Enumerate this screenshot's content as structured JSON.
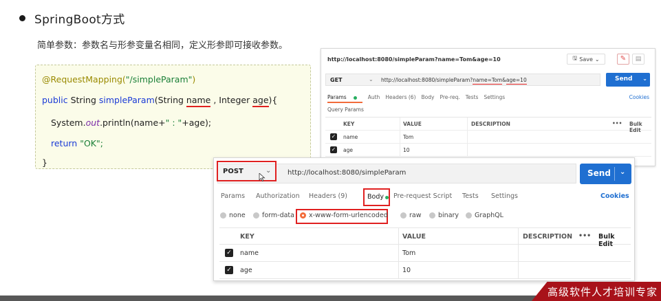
{
  "slide": {
    "heading": "SpringBoot方式",
    "description": "简单参数：参数名与形参变量名相同，定义形参即可接收参数。"
  },
  "code": {
    "annotation": "@RequestMapping(",
    "mapping_path": "\"/simpleParam\"",
    "annotation_close": ")",
    "signature_public": "public",
    "signature_type": " String ",
    "signature_method": "simpleParam",
    "signature_open": "(String ",
    "param_name": "name",
    "signature_mid": " , Integer ",
    "param_age": "age",
    "signature_close": "){",
    "println_obj": "System.",
    "println_out": "out",
    "println_call": ".println(name+",
    "println_str": "\" : \"",
    "println_end": "+age);",
    "return_kw": "return",
    "return_val": " \"OK\";",
    "closing": "}"
  },
  "get_window": {
    "title": "http://localhost:8080/simpleParam?name=Tom&age=10",
    "save_label": "Save",
    "method": "GET",
    "url_prefix": "http://localhost:8080/simpleParam?",
    "url_name": "name=Tom",
    "url_amp": "&",
    "url_age": "age=10",
    "send_label": "Send",
    "tabs": [
      "Params",
      "Auth",
      "Headers (6)",
      "Body",
      "Pre-req.",
      "Tests",
      "Settings"
    ],
    "cookies_label": "Cookies",
    "query_params_label": "Query Params",
    "table_headers": {
      "key": "KEY",
      "value": "VALUE",
      "description": "DESCRIPTION",
      "more": "•••",
      "bulk_edit": "Bulk Edit"
    },
    "rows": [
      {
        "key": "name",
        "value": "Tom"
      },
      {
        "key": "age",
        "value": "10"
      }
    ]
  },
  "post_window": {
    "method": "POST",
    "url": "http://localhost:8080/simpleParam",
    "send_label": "Send",
    "tabs": [
      "Params",
      "Authorization",
      "Headers (9)",
      "Body",
      "Pre-request Script",
      "Tests",
      "Settings"
    ],
    "cookies_label": "Cookies",
    "body_types": [
      "none",
      "form-data",
      "x-www-form-urlencoded",
      "raw",
      "binary",
      "GraphQL"
    ],
    "selected_body_type": "x-www-form-urlencoded",
    "table_headers": {
      "key": "KEY",
      "value": "VALUE",
      "description": "DESCRIPTION",
      "more": "•••",
      "bulk_edit": "Bulk Edit"
    },
    "rows": [
      {
        "key": "name",
        "value": "Tom"
      },
      {
        "key": "age",
        "value": "10"
      }
    ]
  },
  "footer": {
    "brand_text": "高级软件人才培训专家"
  },
  "colors": {
    "send_blue": "#1f6fd1",
    "highlight_red": "#e02020",
    "active_orange": "#f26b3a",
    "code_bg": "#fbfce9",
    "brand_red": "#a8121a"
  }
}
